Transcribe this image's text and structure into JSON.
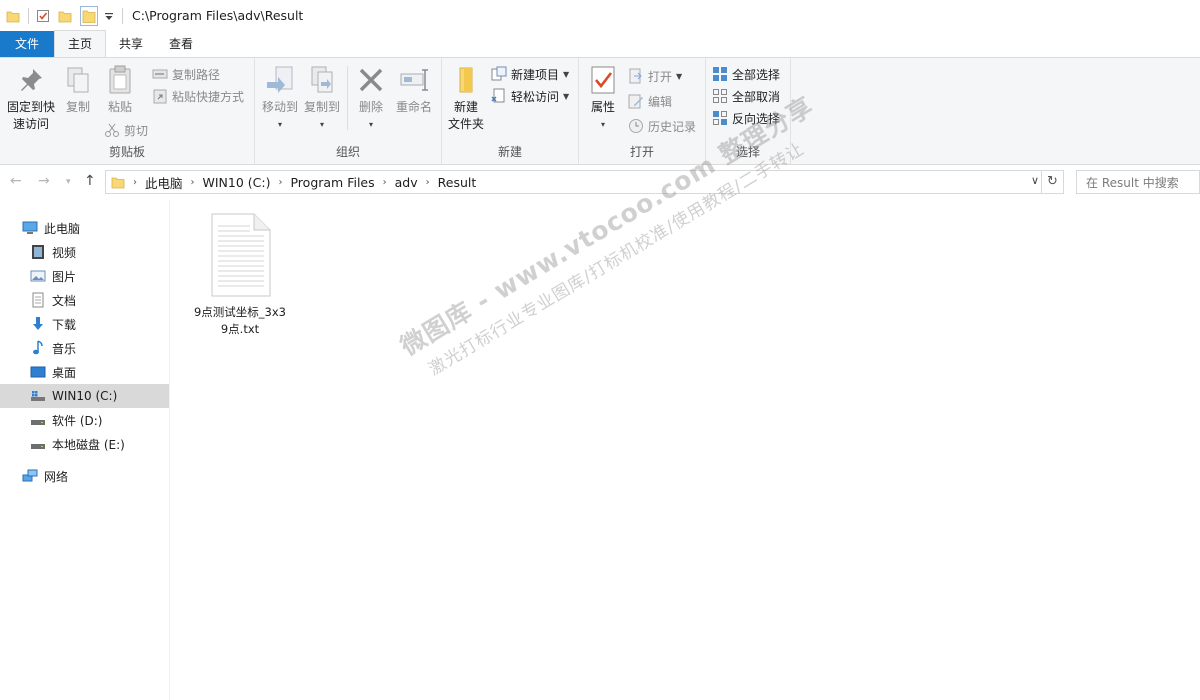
{
  "titlebar": {
    "path": "C:\\Program Files\\adv\\Result"
  },
  "tabs": {
    "file": "文件",
    "home": "主页",
    "share": "共享",
    "view": "查看"
  },
  "ribbon": {
    "clipboard": {
      "label": "剪贴板",
      "pin_line1": "固定到快",
      "pin_line2": "速访问",
      "copy": "复制",
      "paste": "粘贴",
      "copy_path": "复制路径",
      "paste_shortcut": "粘贴快捷方式",
      "cut": "剪切"
    },
    "organize": {
      "label": "组织",
      "move_to": "移动到",
      "copy_to": "复制到",
      "delete": "删除",
      "rename": "重命名"
    },
    "new": {
      "label": "新建",
      "new_folder_line1": "新建",
      "new_folder_line2": "文件夹",
      "new_item": "新建项目",
      "easy_access": "轻松访问"
    },
    "open": {
      "label": "打开",
      "properties": "属性",
      "open": "打开",
      "edit": "编辑",
      "history": "历史记录"
    },
    "select": {
      "label": "选择",
      "select_all": "全部选择",
      "select_none": "全部取消",
      "invert": "反向选择"
    }
  },
  "breadcrumb": [
    "此电脑",
    "WIN10 (C:)",
    "Program Files",
    "adv",
    "Result"
  ],
  "search": {
    "placeholder": "在 Result 中搜索"
  },
  "nav": {
    "this_pc": "此电脑",
    "videos": "视频",
    "pictures": "图片",
    "documents": "文档",
    "downloads": "下载",
    "music": "音乐",
    "desktop": "桌面",
    "drive_c": "WIN10 (C:)",
    "drive_d": "软件 (D:)",
    "drive_e": "本地磁盘 (E:)",
    "network": "网络"
  },
  "files": [
    {
      "name_line1": "9点测试坐标_3x3",
      "name_line2": "9点.txt"
    }
  ],
  "watermark": {
    "line1": "微图库 - www.vtocoo.com 整理分享",
    "line2": "激光打标行业专业图库/打标机校准/使用教程/二手转让"
  },
  "colors": {
    "accent": "#1979ca",
    "selected": "#d9d9d9",
    "ribbon_bg": "#f5f6f7"
  }
}
